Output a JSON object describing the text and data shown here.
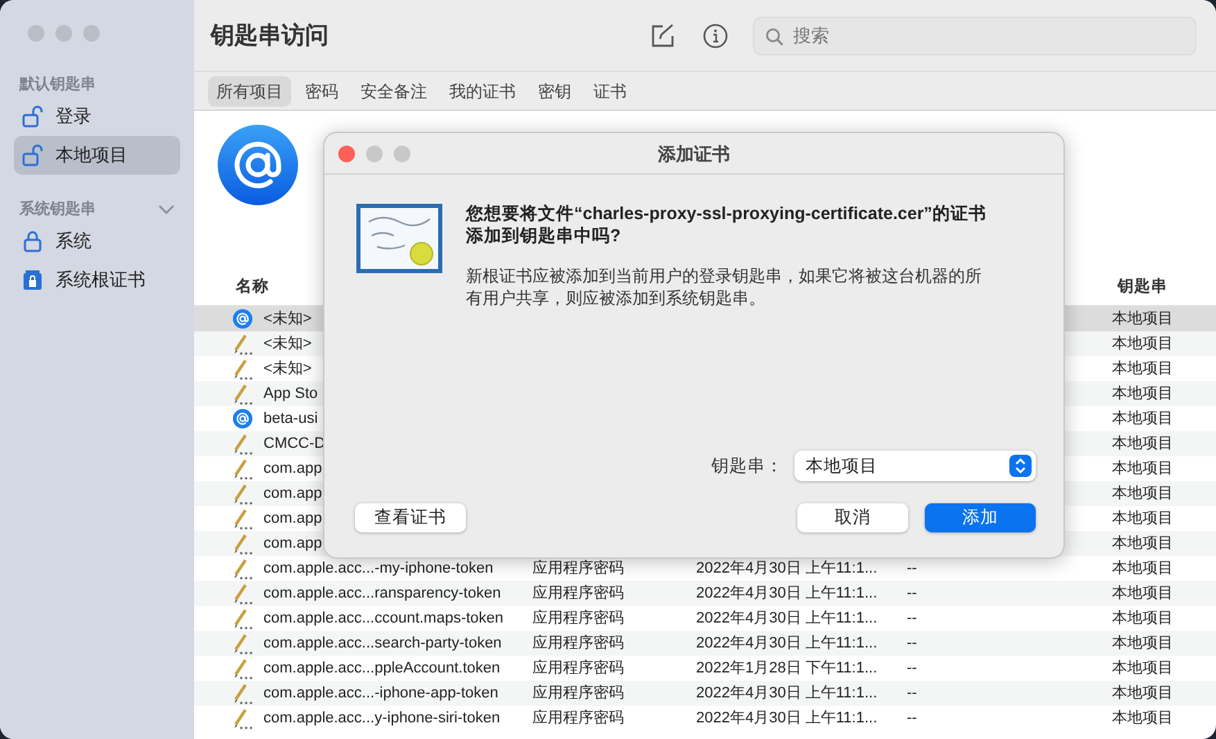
{
  "window": {
    "title": "钥匙串访问"
  },
  "sidebar": {
    "sections": [
      {
        "title": "默认钥匙串",
        "items": [
          {
            "label": "登录",
            "kind": "unlocked",
            "selected": false
          },
          {
            "label": "本地项目",
            "kind": "unlocked",
            "selected": true
          }
        ]
      },
      {
        "title": "系统钥匙串",
        "expanded": true,
        "items": [
          {
            "label": "系统",
            "kind": "locked",
            "selected": false
          },
          {
            "label": "系统根证书",
            "kind": "lockbox",
            "selected": false
          }
        ]
      }
    ]
  },
  "search": {
    "placeholder": "搜索"
  },
  "tabs": [
    {
      "label": "所有项目",
      "selected": true
    },
    {
      "label": "密码",
      "selected": false
    },
    {
      "label": "安全备注",
      "selected": false
    },
    {
      "label": "我的证书",
      "selected": false
    },
    {
      "label": "密钥",
      "selected": false
    },
    {
      "label": "证书",
      "selected": false
    }
  ],
  "table": {
    "columns": [
      {
        "label": "名称"
      },
      {
        "label": "钥匙串"
      }
    ],
    "rows": [
      {
        "kind": "internet",
        "name": "<未知>",
        "keychain": "本地项目",
        "selected": true
      },
      {
        "kind": "password",
        "name": "<未知>",
        "keychain": "本地项目",
        "selected": false
      },
      {
        "kind": "password",
        "name": "<未知>",
        "keychain": "本地项目",
        "selected": false
      },
      {
        "kind": "password",
        "name": "App Sto",
        "keychain": "本地项目",
        "selected": false
      },
      {
        "kind": "internet",
        "name": "beta-usi",
        "keychain": "本地项目",
        "selected": false
      },
      {
        "kind": "password",
        "name": "CMCC-D",
        "keychain": "本地项目",
        "selected": false
      },
      {
        "kind": "password",
        "name": "com.app",
        "keychain": "本地项目",
        "selected": false
      },
      {
        "kind": "password",
        "name": "com.app",
        "keychain": "本地项目",
        "selected": false
      },
      {
        "kind": "password",
        "name": "com.app",
        "keychain": "本地项目",
        "selected": false
      },
      {
        "kind": "password",
        "name": "com.app",
        "keychain": "本地项目",
        "selected": false
      },
      {
        "kind": "password",
        "name": "com.apple.acc...-my-iphone-token",
        "type": "应用程序密码",
        "date": "2022年4月30日 上午11:1...",
        "expires": "--",
        "keychain": "本地项目",
        "selected": false
      },
      {
        "kind": "password",
        "name": "com.apple.acc...ransparency-token",
        "type": "应用程序密码",
        "date": "2022年4月30日 上午11:1...",
        "expires": "--",
        "keychain": "本地项目",
        "selected": false
      },
      {
        "kind": "password",
        "name": "com.apple.acc...ccount.maps-token",
        "type": "应用程序密码",
        "date": "2022年4月30日 上午11:1...",
        "expires": "--",
        "keychain": "本地项目",
        "selected": false
      },
      {
        "kind": "password",
        "name": "com.apple.acc...search-party-token",
        "type": "应用程序密码",
        "date": "2022年4月30日 上午11:1...",
        "expires": "--",
        "keychain": "本地项目",
        "selected": false
      },
      {
        "kind": "password",
        "name": "com.apple.acc...ppleAccount.token",
        "type": "应用程序密码",
        "date": "2022年1月28日 下午11:1...",
        "expires": "--",
        "keychain": "本地项目",
        "selected": false
      },
      {
        "kind": "password",
        "name": "com.apple.acc...-iphone-app-token",
        "type": "应用程序密码",
        "date": "2022年4月30日 上午11:1...",
        "expires": "--",
        "keychain": "本地项目",
        "selected": false
      },
      {
        "kind": "password",
        "name": "com.apple.acc...y-iphone-siri-token",
        "type": "应用程序密码",
        "date": "2022年4月30日 上午11:1...",
        "expires": "--",
        "keychain": "本地项目",
        "selected": false
      }
    ]
  },
  "dialog": {
    "title": "添加证书",
    "message": "您想要将文件“charles-proxy-ssl-proxying-certificate.cer”的证书添加到钥匙串中吗?",
    "body": "新根证书应被添加到当前用户的登录钥匙串，如果它将被这台机器的所有用户共享，则应被添加到系统钥匙串。",
    "keychain_label": "钥匙串：",
    "keychain_value": "本地项目",
    "buttons": [
      {
        "label": "查看证书",
        "kind": "help"
      },
      {
        "label": "取消",
        "kind": "cancel"
      },
      {
        "label": "添加",
        "kind": "default"
      }
    ]
  }
}
